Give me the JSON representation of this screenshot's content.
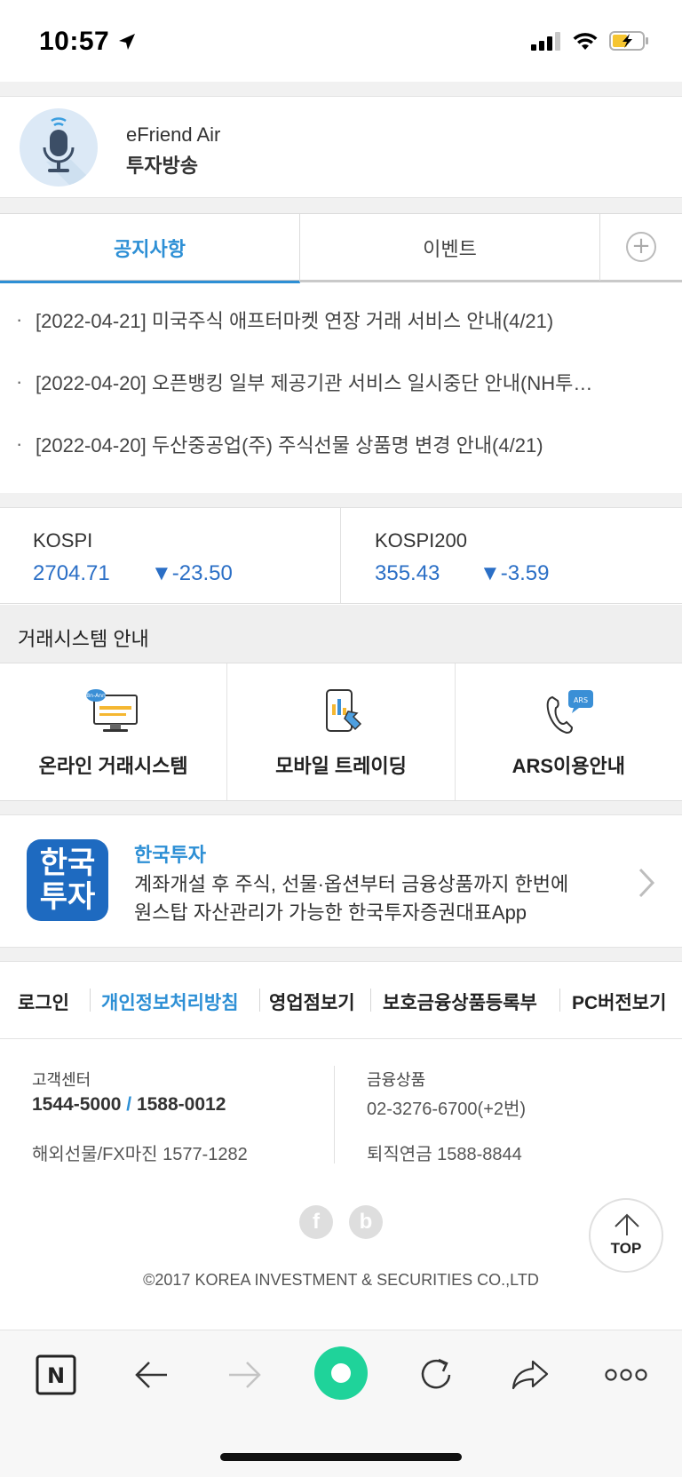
{
  "status_bar": {
    "time": "10:57",
    "icons": [
      "location-arrow-icon",
      "cellular-signal-icon",
      "wifi-icon",
      "battery-charging-icon"
    ]
  },
  "broadcast": {
    "title": "eFriend Air",
    "subtitle": "투자방송",
    "icon": "microphone-icon",
    "icon_bg_color": "#dce9f6"
  },
  "tabs": [
    {
      "label": "공지사항",
      "active": true
    },
    {
      "label": "이벤트",
      "active": false
    }
  ],
  "notices": [
    {
      "text": "[2022-04-21] 미국주식 애프터마켓 연장 거래 서비스 안내(4/21)"
    },
    {
      "text": "[2022-04-20] 오픈뱅킹 일부 제공기관 서비스 일시중단 안내(NH투…"
    },
    {
      "text": "[2022-04-20] 두산중공업(주) 주식선물 상품명 변경 안내(4/21)"
    }
  ],
  "indices": [
    {
      "name": "KOSPI",
      "value": "2704.71",
      "change": "▼-23.50"
    },
    {
      "name": "KOSPI200",
      "value": "355.43",
      "change": "▼-3.59"
    }
  ],
  "trading_systems": {
    "heading": "거래시스템 안내",
    "items": [
      {
        "label": "온라인 거래시스템",
        "icon": "desktop-monitor-icon",
        "icon_badge": "Bn-Ann"
      },
      {
        "label": "모바일 트레이딩",
        "icon": "mobile-tap-icon"
      },
      {
        "label": "ARS이용안내",
        "icon": "phone-ars-icon",
        "icon_badge": "ARS"
      }
    ]
  },
  "app_banner": {
    "logo_line1": "한국",
    "logo_line2": "투자",
    "name": "한국투자",
    "desc_line1": "계좌개설 후 주식, 선물·옵션부터 금융상품까지 한번에",
    "desc_line2": "원스탑 자산관리가 가능한 한국투자증권대표App"
  },
  "footer_links": [
    "로그인",
    "개인정보처리방침",
    "영업점보기",
    "보호금융상품등록부",
    "PC버전보기"
  ],
  "contact": {
    "customer_center_label": "고객센터",
    "customer_center_phone1": "1544-5000",
    "customer_center_sep": " / ",
    "customer_center_phone2": "1588-0012",
    "overseas_futures": "해외선물/FX마진 1577-1282",
    "financial_products_label": "금융상품",
    "financial_products_phone": "02-3276-6700(+2번)",
    "retirement_pension": "퇴직연금 1588-8844"
  },
  "social": [
    {
      "label": "f",
      "icon": "facebook-icon"
    },
    {
      "label": "b",
      "icon": "blog-icon"
    }
  ],
  "top_button": {
    "label": "TOP"
  },
  "copyright": "©2017 KOREA INVESTMENT & SECURITIES CO.,LTD",
  "browser_toolbar": {
    "items": [
      "naver-icon",
      "back-arrow-icon",
      "forward-arrow-icon",
      "green-dot-icon",
      "refresh-icon",
      "share-icon",
      "more-icon"
    ],
    "naver_label": "N"
  },
  "colors": {
    "accent_blue": "#2d8fd5",
    "index_blue": "#2b6fc6",
    "logo_blue": "#1e6ac0",
    "green_button": "#1fd39a"
  }
}
